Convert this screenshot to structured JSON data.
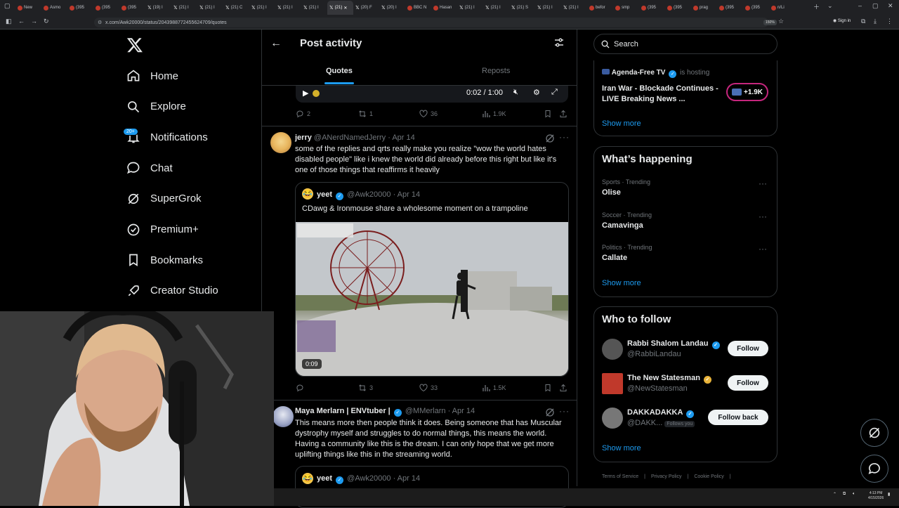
{
  "browser": {
    "tabs": [
      {
        "label": "New",
        "icon": "chrome-icon"
      },
      {
        "label": "Asmo",
        "icon": "favicon-icon"
      },
      {
        "label": "(395",
        "icon": "favicon-icon"
      },
      {
        "label": "(395",
        "icon": "favicon-icon"
      },
      {
        "label": "(395",
        "icon": "favicon-icon"
      },
      {
        "label": "(19) I",
        "icon": "x-icon"
      },
      {
        "label": "(21) I",
        "icon": "x-icon"
      },
      {
        "label": "(21) I",
        "icon": "x-icon"
      },
      {
        "label": "(21) C",
        "icon": "x-icon"
      },
      {
        "label": "(21) I",
        "icon": "x-icon"
      },
      {
        "label": "(21) I",
        "icon": "x-icon"
      },
      {
        "label": "(21) I",
        "icon": "x-icon"
      },
      {
        "label": "(21)",
        "icon": "x-icon",
        "active": true
      },
      {
        "label": "(20) F",
        "icon": "x-icon"
      },
      {
        "label": "(20) I",
        "icon": "x-icon"
      },
      {
        "label": "BBC N",
        "icon": "favicon-icon"
      },
      {
        "label": "Hasan",
        "icon": "favicon-icon"
      },
      {
        "label": "(21) I",
        "icon": "x-icon"
      },
      {
        "label": "(21) I",
        "icon": "x-icon"
      },
      {
        "label": "(21) S",
        "icon": "x-icon"
      },
      {
        "label": "(21) I",
        "icon": "x-icon"
      },
      {
        "label": "(21) I",
        "icon": "x-icon"
      },
      {
        "label": "befor",
        "icon": "favicon-icon"
      },
      {
        "label": "smp",
        "icon": "favicon-icon"
      },
      {
        "label": "(395",
        "icon": "favicon-icon"
      },
      {
        "label": "(395",
        "icon": "favicon-icon"
      },
      {
        "label": "prag",
        "icon": "favicon-icon"
      },
      {
        "label": "(395",
        "icon": "favicon-icon"
      },
      {
        "label": "(395",
        "icon": "favicon-icon"
      },
      {
        "label": "n/Li",
        "icon": "favicon-icon"
      }
    ],
    "url": "x.com/Awk20000/status/2043988772455624709/quotes",
    "zoom": "150%",
    "signin": "Sign in",
    "colors": {
      "chrome": "#202124",
      "urlbar": "#282a2d"
    }
  },
  "nav": {
    "items": [
      {
        "label": "Home",
        "icon": "home-icon"
      },
      {
        "label": "Explore",
        "icon": "search-icon"
      },
      {
        "label": "Notifications",
        "icon": "bell-icon"
      },
      {
        "label": "Chat",
        "icon": "chat-icon"
      },
      {
        "label": "SuperGrok",
        "icon": "grok-icon"
      },
      {
        "label": "Premium+",
        "icon": "premium-icon"
      },
      {
        "label": "Bookmarks",
        "icon": "bookmark-icon"
      },
      {
        "label": "Creator Studio",
        "icon": "rocket-icon"
      }
    ],
    "notif_badge": "20+"
  },
  "header": {
    "title": "Post activity",
    "tabs": {
      "quotes": "Quotes",
      "reposts": "Reposts"
    }
  },
  "video_controls": {
    "time": "0:02 / 1:00"
  },
  "post0_actions": {
    "replies": "2",
    "reposts": "1",
    "likes": "36",
    "views": "1.9K"
  },
  "post1": {
    "name": "jerry",
    "handle": "@ANerdNamedJerry",
    "date": "· Apr 14",
    "text": "some of the replies and qrts really make you realize \"wow the world hates disabled people\" like i knew the world did already before this right but like it's one of those things that reaffirms it heavily",
    "quote": {
      "name": "yeet",
      "handle": "@Awk20000",
      "date": "· Apr 14",
      "text": "CDawg & Ironmouse share a wholesome moment on a trampoline",
      "duration": "0:09"
    },
    "actions": {
      "replies": "",
      "reposts": "3",
      "likes": "33",
      "views": "1.5K"
    }
  },
  "post2": {
    "name": "Maya Merlarn | ENVtuber |",
    "handle": "@MMerlarn",
    "date": "· Apr 14",
    "text": "This means more then people think it does.  Being someone that has Muscular dystrophy myself and struggles to do normal things, this means the world.  Having a community like this is the dream.  I can only hope that we get more uplifting things like this in the streaming world.",
    "quote": {
      "name": "yeet",
      "handle": "@Awk20000",
      "date": "· Apr 14"
    }
  },
  "right": {
    "search_placeholder": "Search",
    "live": {
      "host": "Agenda-Free TV",
      "hosting": "is hosting",
      "title": "Iran War - Blockade Continues - LIVE Breaking News ...",
      "count": "+1.9K",
      "show_more": "Show more"
    },
    "happening": {
      "title": "What’s happening",
      "trends": [
        {
          "meta": "Sports · Trending",
          "name": "Olise"
        },
        {
          "meta": "Soccer · Trending",
          "name": "Camavinga"
        },
        {
          "meta": "Politics · Trending",
          "name": "Callate"
        }
      ],
      "show_more": "Show more"
    },
    "follow": {
      "title": "Who to follow",
      "users": [
        {
          "name": "Rabbi Shalom Landau",
          "handle": "@RabbiLandau",
          "button": "Follow",
          "verified": "blue"
        },
        {
          "name": "The New Statesman",
          "handle": "@NewStatesman",
          "button": "Follow",
          "verified": "gold"
        },
        {
          "name": "DAKKADAKKA",
          "handle": "@DAKK...",
          "button": "Follow back",
          "verified": "blue",
          "follows_you": "Follows you"
        }
      ],
      "show_more": "Show more"
    },
    "footer": [
      "Terms of Service",
      "Privacy Policy",
      "Cookie Policy"
    ]
  },
  "taskbar": {
    "time": "4:13 PM",
    "date": "4/15/2026"
  }
}
